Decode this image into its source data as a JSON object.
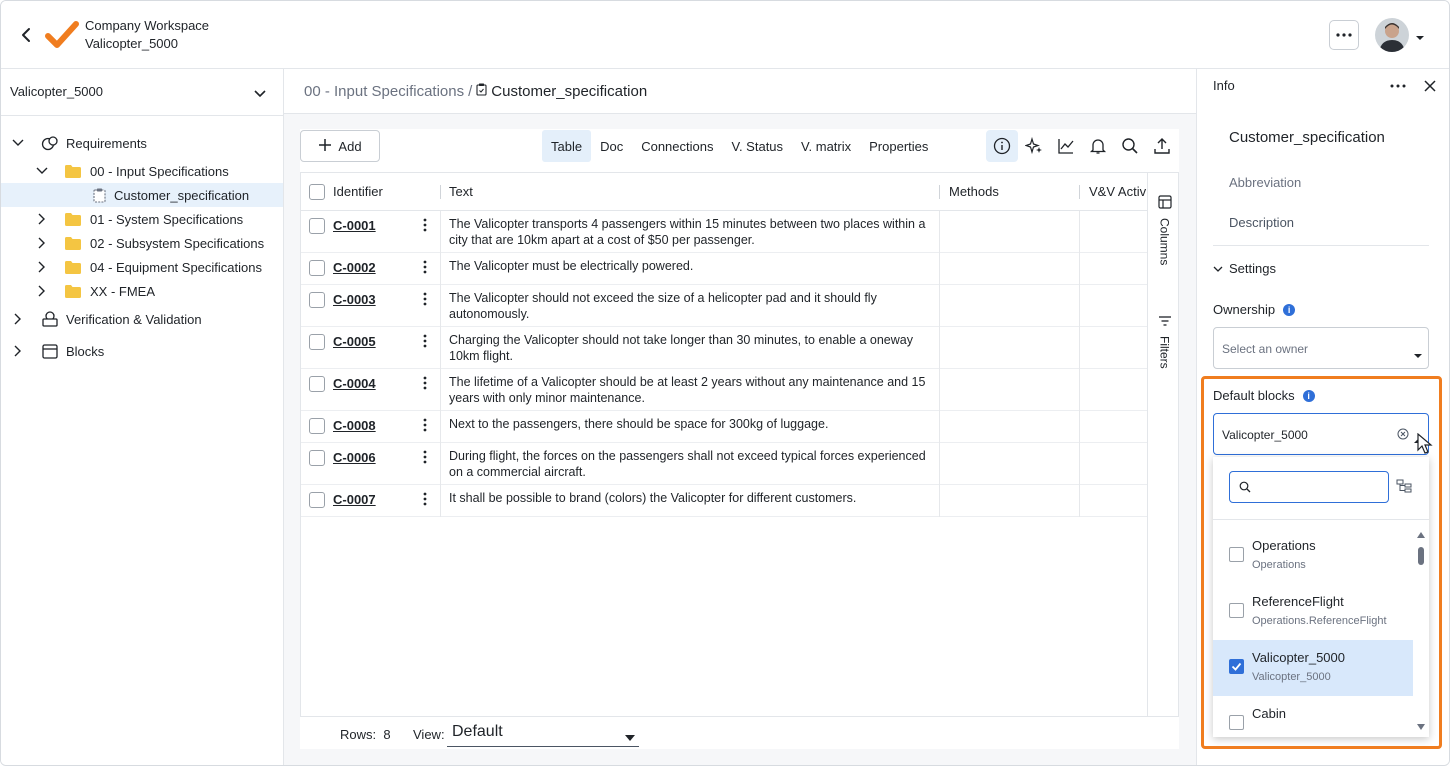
{
  "header": {
    "workspace": "Company Workspace",
    "project": "Valicopter_5000"
  },
  "sidebar": {
    "project_select": "Valicopter_5000",
    "tree": [
      {
        "label": "Requirements",
        "level": 0,
        "expanded": true,
        "icon": "requirements-icon"
      },
      {
        "label": "00 - Input Specifications",
        "level": 1,
        "expanded": true,
        "icon": "folder-icon"
      },
      {
        "label": "Customer_specification",
        "level": 2,
        "selected": true,
        "icon": "document-icon"
      },
      {
        "label": "01 - System Specifications",
        "level": 1,
        "expanded": false,
        "icon": "folder-icon"
      },
      {
        "label": "02 - Subsystem Specifications",
        "level": 1,
        "expanded": false,
        "icon": "folder-icon"
      },
      {
        "label": "04 - Equipment Specifications",
        "level": 1,
        "expanded": false,
        "icon": "folder-icon"
      },
      {
        "label": "XX - FMEA",
        "level": 1,
        "expanded": false,
        "icon": "folder-icon"
      },
      {
        "label": "Verification & Validation",
        "level": 0,
        "expanded": false,
        "icon": "verification-icon"
      },
      {
        "label": "Blocks",
        "level": 0,
        "expanded": false,
        "icon": "blocks-icon"
      }
    ]
  },
  "breadcrumb": {
    "parent": "00 - Input Specifications",
    "separator": "/",
    "current": "Customer_specification"
  },
  "toolbar": {
    "add_label": "Add",
    "tabs": [
      "Table",
      "Doc",
      "Connections",
      "V. Status",
      "V. matrix",
      "Properties"
    ],
    "active_tab": "Table",
    "icons": [
      "info-icon",
      "ai-sparkle-icon",
      "chart-icon",
      "bell-icon",
      "search-icon",
      "export-icon"
    ]
  },
  "table": {
    "columns": [
      "Identifier",
      "Text",
      "Methods",
      "V&V Activ"
    ],
    "rows": [
      {
        "id": "C-0001",
        "text": "The Valicopter transports 4 passengers within 15 minutes between two places within a city that are 10km apart at a cost of $50 per passenger."
      },
      {
        "id": "C-0002",
        "text": "The Valicopter must be electrically powered."
      },
      {
        "id": "C-0003",
        "text": "The Valicopter should not exceed the size of a helicopter pad and it should fly autonomously."
      },
      {
        "id": "C-0005",
        "text": "Charging the Valicopter should not take longer than 30 minutes, to enable a oneway 10km flight."
      },
      {
        "id": "C-0004",
        "text": "The lifetime of a Valicopter should be at least 2 years without any maintenance and 15 years with only minor maintenance."
      },
      {
        "id": "C-0008",
        "text": "Next to the passengers, there should be space for 300kg of luggage."
      },
      {
        "id": "C-0006",
        "text": "During flight, the forces on the passengers shall not exceed typical forces experienced on a commercial aircraft."
      },
      {
        "id": "C-0007",
        "text": "It shall be possible to brand (colors) the Valicopter for different customers."
      }
    ],
    "side_rail": [
      "Columns",
      "Filters"
    ],
    "footer": {
      "rows_label": "Rows:",
      "rows_count": "8",
      "view_label": "View:",
      "view_value": "Default"
    }
  },
  "info_panel": {
    "header": "Info",
    "title": "Customer_specification",
    "abbreviation_label": "Abbreviation",
    "description_label": "Description",
    "settings_label": "Settings",
    "ownership_label": "Ownership",
    "ownership_placeholder": "Select an owner",
    "default_blocks_label": "Default blocks",
    "default_blocks_value": "Valicopter_5000",
    "dropdown": {
      "search_value": "",
      "items": [
        {
          "name": "Operations",
          "path": "Operations",
          "checked": false
        },
        {
          "name": "ReferenceFlight",
          "path": "Operations.ReferenceFlight",
          "checked": false
        },
        {
          "name": "Valicopter_5000",
          "path": "Valicopter_5000",
          "checked": true
        },
        {
          "name": "Cabin",
          "path": "",
          "checked": false
        }
      ]
    }
  },
  "colors": {
    "accent": "#2f6fd8",
    "highlight": "#f07d1f",
    "selected_bg": "#e7f1fb",
    "logo_orange": "#f07d1f"
  }
}
